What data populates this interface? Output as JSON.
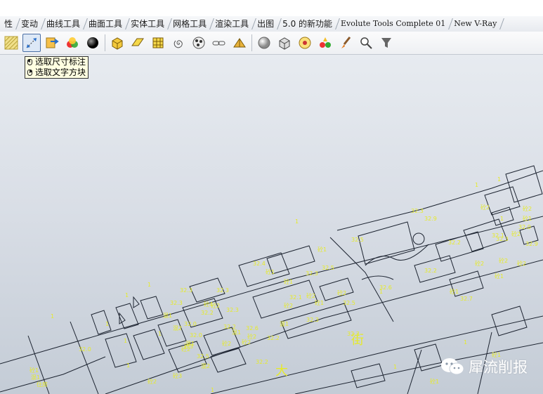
{
  "tabs": [
    "性",
    "变动",
    "曲线工具",
    "曲面工具",
    "实体工具",
    "网格工具",
    "渲染工具",
    "出图",
    "5.0 的新功能",
    "Evolute Tools Complete 01",
    "New V-Ray"
  ],
  "toolbar_icons": [
    "hatch-icon",
    "select-dimension-icon",
    "select-layer-icon",
    "material-icon",
    "sphere-icon",
    "extrude-icon",
    "surface-icon",
    "mesh-icon",
    "spiral-icon",
    "dots-icon",
    "link-icon",
    "shade-icon",
    "render-sphere-icon",
    "box-icon",
    "environment-icon",
    "light-icon",
    "brush-icon",
    "zoom-icon",
    "filter-icon"
  ],
  "tooltip": {
    "line1": "选取尺寸标注",
    "line2": "选取文字方块"
  },
  "plan": {
    "street_chars": [
      "大",
      "街"
    ],
    "labels": [
      "1",
      "1",
      "1",
      "1",
      "1",
      "1",
      "1",
      "1",
      "1",
      "1",
      "1",
      "1",
      "1",
      "1",
      "1",
      "32.0",
      "32.3",
      "32.3",
      "32.3",
      "32.2",
      "32.2",
      "32.5",
      "32.6",
      "32.7",
      "32.2",
      "32.1",
      "32.9",
      "32.5",
      "32.5",
      "32.2",
      "32.0",
      "32.3",
      "32.3",
      "32.2",
      "32.3",
      "32.1",
      "32.3",
      "32.4",
      "32.0",
      "32.5",
      "32.2",
      "32.6",
      "32.0",
      "32.9",
      "32.3",
      "32.3",
      "砼1",
      "砼2",
      "砼3",
      "砼2",
      "砼4",
      "砼1",
      "砼2",
      "砼2",
      "砼1",
      "砼2",
      "砼1",
      "砼2",
      "砼2",
      "砼2",
      "砼1",
      "砼1",
      "砼2",
      "砼3",
      "砼2",
      "砼2",
      "砼1",
      "砼1",
      "混1",
      "混2",
      "混1",
      "混2",
      "混1",
      "混1",
      "砼2",
      "砼1",
      "砼2",
      "砼2",
      "砼2",
      "砼1",
      "混1",
      "住房"
    ]
  },
  "watermark": {
    "text": "犀流削报",
    "icon": "wechat-icon"
  },
  "colors": {
    "label": "#e6ea2a",
    "line": "#1c2330",
    "accent": "#4a6fa5"
  }
}
